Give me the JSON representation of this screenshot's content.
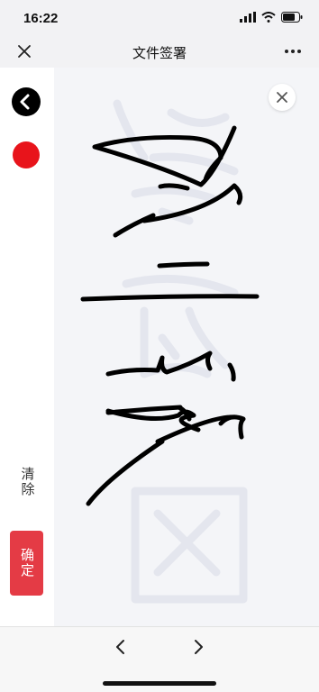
{
  "status_bar": {
    "time": "16:22"
  },
  "nav": {
    "title": "文件签署"
  },
  "side_panel": {
    "clear_label": "清除",
    "confirm_label": "确定",
    "pen_color": "#e8141b"
  },
  "canvas": {
    "background": "#f4f5f8"
  },
  "icons": {
    "nav_close": "close-icon",
    "nav_more": "more-icon",
    "back": "back-arrow-icon",
    "canvas_close": "close-icon",
    "prev": "chevron-left-icon",
    "next": "chevron-right-icon"
  }
}
